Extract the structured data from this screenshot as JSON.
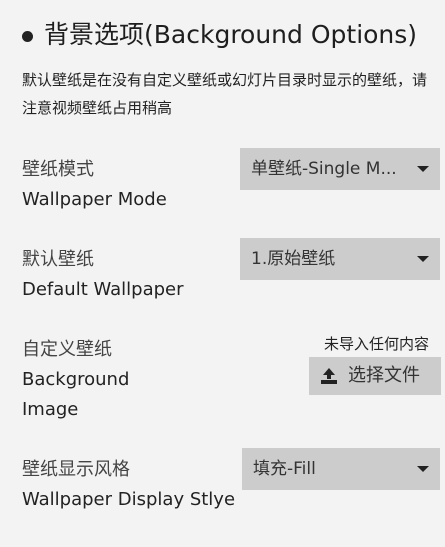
{
  "section": {
    "title": "背景选项(Background Options)",
    "description": "默认壁纸是在没有自定义壁纸或幻灯片目录时显示的壁纸，请注意视频壁纸占用稍高"
  },
  "settings": {
    "wallpaper_mode": {
      "label_cn": "壁纸模式",
      "label_en": "Wallpaper Mode",
      "value": "单壁纸-Single M..."
    },
    "default_wallpaper": {
      "label_cn": "默认壁纸",
      "label_en": "Default Wallpaper",
      "value": "1.原始壁纸"
    },
    "background_image": {
      "label_cn": "自定义壁纸",
      "label_en_1": "Background",
      "label_en_2": "Image",
      "status": "未导入任何内容",
      "button_label": "选择文件",
      "button_icon": "upload-icon"
    },
    "display_style": {
      "label_cn": "壁纸显示风格",
      "label_en": "Wallpaper Display Stlye",
      "value": "填充-Fill"
    }
  },
  "colors": {
    "background": "#f3f3f3",
    "control_bg": "#cccccc",
    "text": "#222222"
  }
}
